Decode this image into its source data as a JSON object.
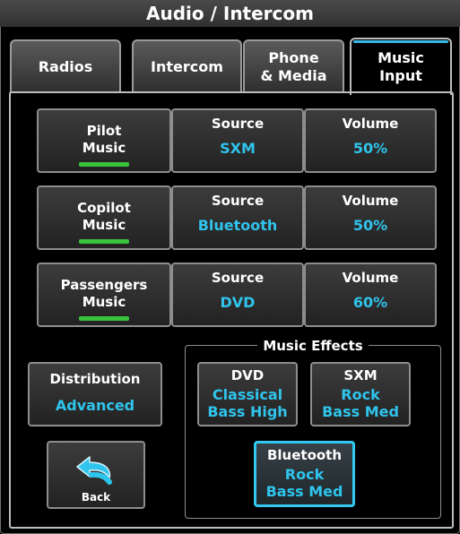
{
  "title": "Audio / Intercom",
  "tabs": [
    {
      "lines": [
        "Radios"
      ],
      "active": false
    },
    {
      "lines": [
        "Intercom"
      ],
      "active": false
    },
    {
      "lines": [
        "Phone",
        "& Media"
      ],
      "active": false
    },
    {
      "lines": [
        "Music",
        "Input"
      ],
      "active": true
    }
  ],
  "music_rows": [
    {
      "name_lines": [
        "Pilot",
        "Music"
      ],
      "source_label": "Source",
      "source": "SXM",
      "volume_label": "Volume",
      "volume": "50%"
    },
    {
      "name_lines": [
        "Copilot",
        "Music"
      ],
      "source_label": "Source",
      "source": "Bluetooth",
      "volume_label": "Volume",
      "volume": "50%"
    },
    {
      "name_lines": [
        "Passengers",
        "Music"
      ],
      "source_label": "Source",
      "source": "DVD",
      "volume_label": "Volume",
      "volume": "60%"
    }
  ],
  "distribution": {
    "label": "Distribution",
    "value": "Advanced"
  },
  "back": {
    "label": "Back"
  },
  "music_effects": {
    "title": "Music Effects",
    "dvd": {
      "label": "DVD",
      "lines": [
        "Classical",
        "Bass High"
      ]
    },
    "sxm": {
      "label": "SXM",
      "lines": [
        "Rock",
        "Bass Med"
      ]
    },
    "bluetooth": {
      "label": "Bluetooth",
      "lines": [
        "Rock",
        "Bass Med"
      ]
    }
  },
  "colors": {
    "accent": "#2fc4ec",
    "annunciator": "#39c23c",
    "border": "#8d8d8d"
  },
  "icons": {
    "back": "back-arrow-icon"
  }
}
